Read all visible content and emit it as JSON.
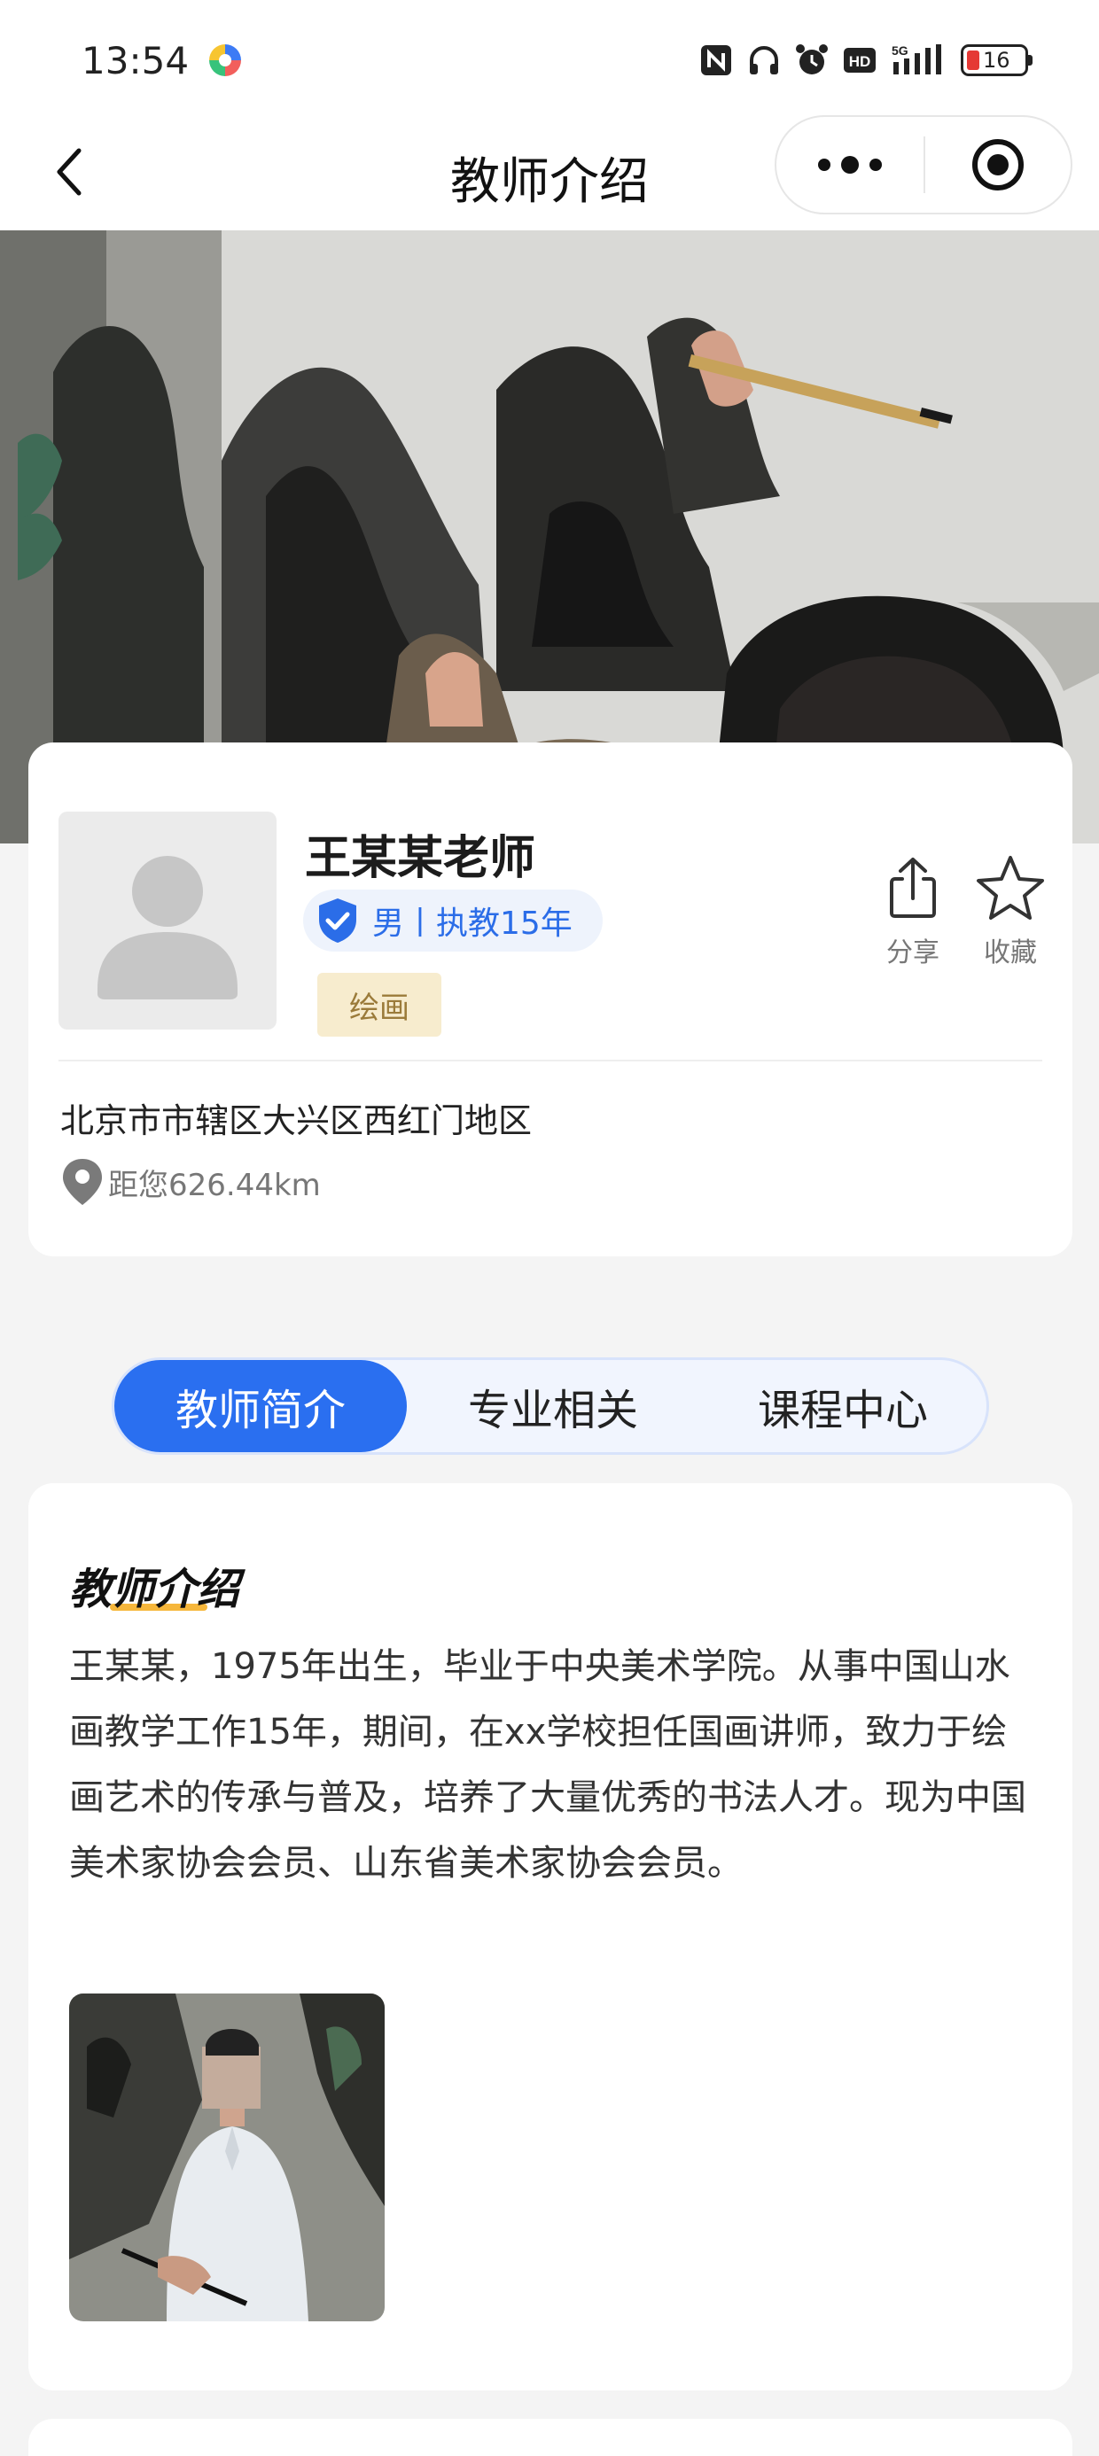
{
  "status_bar": {
    "time": "13:54",
    "battery": "16",
    "icons": [
      "nfc-icon",
      "headphones-icon",
      "alarm-icon",
      "hd-icon",
      "5g-signal-icon",
      "battery-icon"
    ]
  },
  "nav": {
    "title": "教师介绍"
  },
  "teacher": {
    "name": "王某某老师",
    "badge": "男丨执教15年",
    "tag": "绘画",
    "address": "北京市市辖区大兴区西红门地区",
    "distance": "距您626.44km",
    "actions": {
      "share": "分享",
      "favorite": "收藏"
    }
  },
  "tabs": [
    {
      "label": "教师简介",
      "active": true
    },
    {
      "label": "专业相关",
      "active": false
    },
    {
      "label": "课程中心",
      "active": false
    }
  ],
  "intro": {
    "title": "教师介绍",
    "text": "王某某，1975年出生，毕业于中央美术学院。从事中国山水画教学工作15年，期间，在xx学校担任国画讲师，致力于绘画艺术的传承与普及，培养了大量优秀的书法人才。现为中国美术家协会会员、山东省美术家协会会员。"
  },
  "colors": {
    "accent": "#2a6ff0",
    "tag_bg": "#f7ecce",
    "tag_text": "#9b7b3a",
    "underline": "#f6b73c"
  }
}
